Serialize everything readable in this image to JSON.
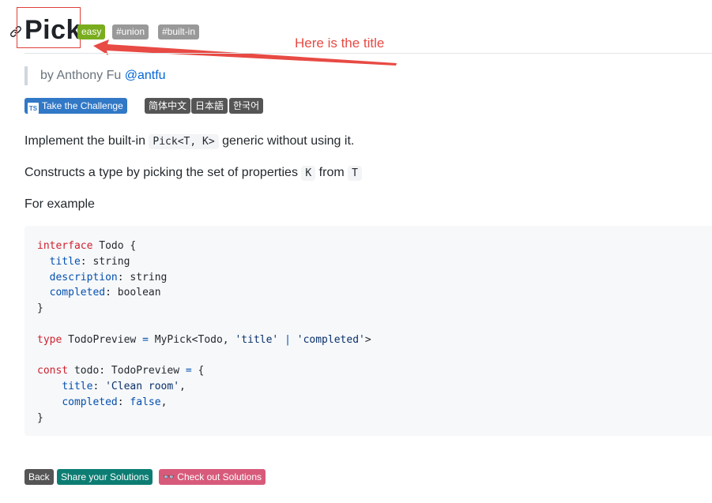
{
  "header": {
    "title": "Pick",
    "link_icon": "link-icon",
    "tags": {
      "difficulty": "easy",
      "union": "#union",
      "builtin": "#built-in"
    }
  },
  "annotation": {
    "text": "Here is the title",
    "color": "#e84a44"
  },
  "author": {
    "prefix": "by Anthony Fu",
    "handle": "@antfu"
  },
  "actions": {
    "take_challenge": "Take the Challenge",
    "ts_logo": "TS",
    "lang_zh": "简体中文",
    "lang_ja": "日本語",
    "lang_ko": "한국어"
  },
  "description": {
    "p1_before": "Implement the built-in ",
    "p1_code": "Pick<T, K>",
    "p1_after": " generic without using it.",
    "p2_before": "Constructs a type by picking the set of properties ",
    "p2_code1": "K",
    "p2_mid": " from ",
    "p2_code2": "T",
    "p3": "For example"
  },
  "code": {
    "l1_kw": "interface",
    "l1_rest": " Todo {",
    "l2_prop": "title",
    "l2_rest": ": string",
    "l3_prop": "description",
    "l3_rest": ": string",
    "l4_prop": "completed",
    "l4_rest": ": boolean",
    "l5": "}",
    "l7_kw": "type",
    "l7_a": " TodoPreview ",
    "l7_eq": "=",
    "l7_b": " MyPick<Todo, ",
    "l7_s1": "'title'",
    "l7_pipe": "|",
    "l7_s2": "'completed'",
    "l7_c": ">",
    "l9_kw": "const",
    "l9_a": " todo: TodoPreview ",
    "l9_eq": "=",
    "l9_b": " {",
    "l10_prop": "title",
    "l10_colon": ": ",
    "l10_str": "'Clean room'",
    "l10_comma": ",",
    "l11_prop": "completed",
    "l11_colon": ": ",
    "l11_val": "false",
    "l11_comma": ",",
    "l12": "}"
  },
  "footer": {
    "back": "Back",
    "share": "Share your Solutions",
    "check": "👓 Check out Solutions"
  },
  "colors": {
    "easy": "#7aad1e",
    "tag": "#999999",
    "challenge": "#3178c6",
    "share": "#0d7d73",
    "check": "#d85a7b"
  }
}
